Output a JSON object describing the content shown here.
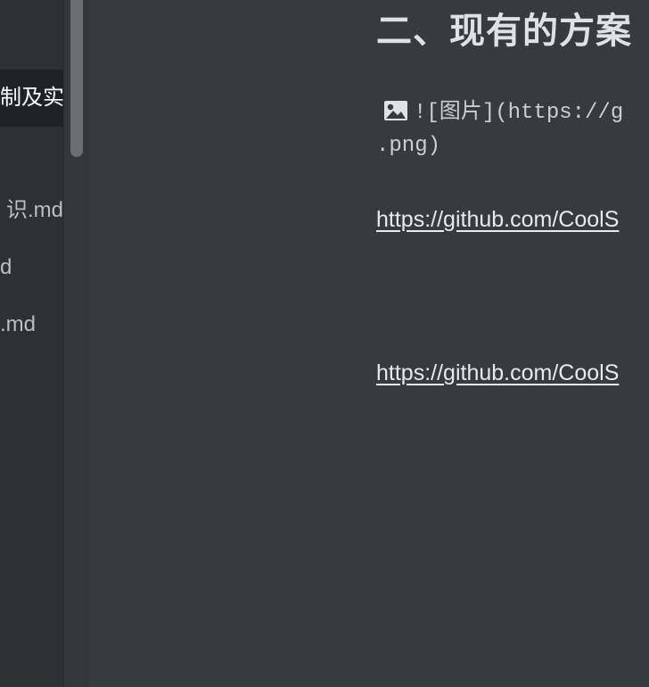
{
  "sidebar": {
    "files": [
      {
        "label": "制及实",
        "active": true
      },
      {
        "label": "识.md",
        "active": false
      },
      {
        "label": "d",
        "active": false
      },
      {
        "label": ".md",
        "active": false
      }
    ]
  },
  "editor": {
    "heading": "二、现有的方案",
    "image_markdown": "![图片](https://g",
    "image_markdown_cont": ".png)",
    "links": [
      "https://github.com/CoolS",
      "https://github.com/CoolS"
    ],
    "icons": {
      "image": "image-icon"
    }
  },
  "colors": {
    "background": "#363b40",
    "sidebar": "#2e3033",
    "active_item": "#202325",
    "text": "#dde2e7"
  }
}
